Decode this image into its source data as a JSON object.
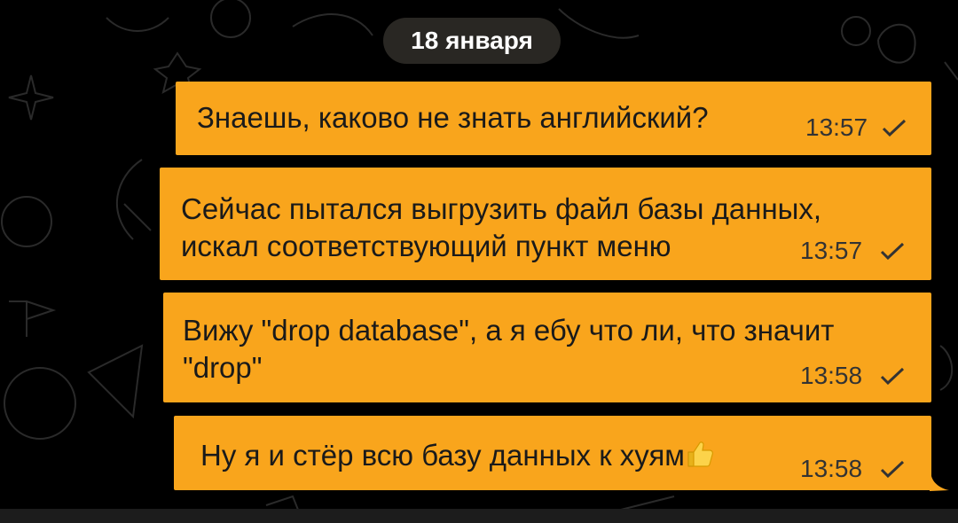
{
  "date_separator": "18 января",
  "messages": [
    {
      "text": "Знаешь, каково не знать английский?",
      "time": "13:57",
      "status": "sent-check"
    },
    {
      "text": "Сейчас пытался выгрузить файл базы данных,\nискал соответствующий пункт меню",
      "time": "13:57",
      "status": "sent-check"
    },
    {
      "text": "Вижу \"drop database\", а я ебу что ли, что значит\n\"drop\"",
      "time": "13:58",
      "status": "sent-check"
    },
    {
      "text": "Ну я и стёр всю базу данных к хуям",
      "time": "13:58",
      "status": "sent-check",
      "emoji": "thumbs-up-emoji"
    }
  ],
  "colors": {
    "bubble": "#f9a51c",
    "background": "#000000",
    "date_pill": "#2d2a26"
  }
}
